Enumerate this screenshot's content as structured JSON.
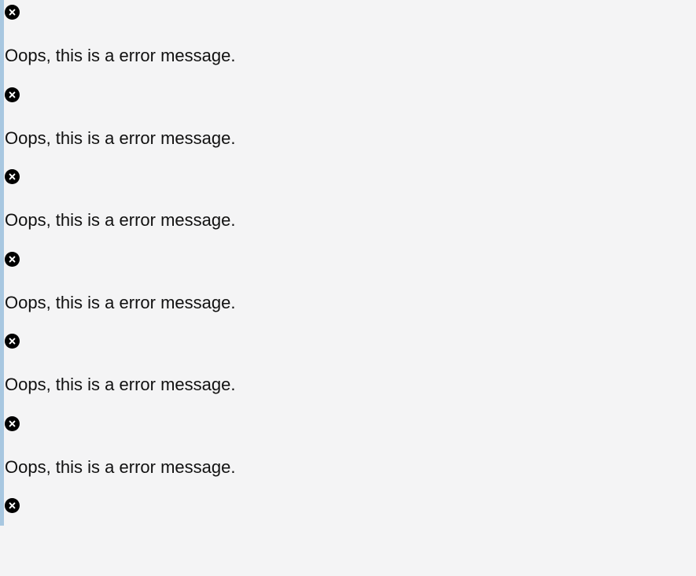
{
  "accent_color": "#a8c7e0",
  "close_icon": "close-circle-icon",
  "messages": [
    {
      "text": "Oops, this is a error message."
    },
    {
      "text": "Oops, this is a error message."
    },
    {
      "text": "Oops, this is a error message."
    },
    {
      "text": "Oops, this is a error message."
    },
    {
      "text": "Oops, this is a error message."
    },
    {
      "text": "Oops, this is a error message."
    },
    {
      "text": ""
    }
  ]
}
